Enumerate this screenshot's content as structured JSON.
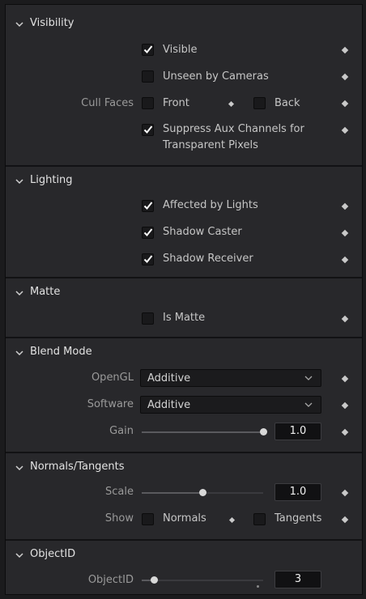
{
  "sections": {
    "visibility": {
      "title": "Visibility",
      "visible": {
        "label": "Visible",
        "checked": true
      },
      "unseen": {
        "label": "Unseen by Cameras",
        "checked": false
      },
      "cull_faces": {
        "label": "Cull Faces",
        "front": {
          "label": "Front",
          "checked": false
        },
        "back": {
          "label": "Back",
          "checked": false
        }
      },
      "suppress": {
        "label_line1": "Suppress Aux Channels for",
        "label_line2": "Transparent Pixels",
        "checked": true
      }
    },
    "lighting": {
      "title": "Lighting",
      "affected": {
        "label": "Affected by Lights",
        "checked": true
      },
      "caster": {
        "label": "Shadow Caster",
        "checked": true
      },
      "receiver": {
        "label": "Shadow Receiver",
        "checked": true
      }
    },
    "matte": {
      "title": "Matte",
      "is_matte": {
        "label": "Is Matte",
        "checked": false
      }
    },
    "blend_mode": {
      "title": "Blend Mode",
      "opengl": {
        "label": "OpenGL",
        "value": "Additive"
      },
      "software": {
        "label": "Software",
        "value": "Additive"
      },
      "gain": {
        "label": "Gain",
        "value": "1.0",
        "slider_fraction": 1.0
      }
    },
    "normals": {
      "title": "Normals/Tangents",
      "scale": {
        "label": "Scale",
        "value": "1.0",
        "slider_fraction": 0.5
      },
      "show": {
        "label": "Show",
        "normals": {
          "label": "Normals",
          "checked": false
        },
        "tangents": {
          "label": "Tangents",
          "checked": false
        }
      }
    },
    "objectid": {
      "title": "ObjectID",
      "objectid": {
        "label": "ObjectID",
        "value": "3",
        "slider_fraction": 0.1
      }
    }
  },
  "colors": {
    "panel": "#28282b",
    "background": "#1b1b1d",
    "checkmark": "#ffffff",
    "keyframe": "#c9c9c9"
  },
  "icons": {
    "section_toggle": "chevron-down-icon",
    "checkbox_mark": "checkmark-icon",
    "keyframe": "diamond-keyframe-icon",
    "dropdown": "chevron-down-icon"
  }
}
